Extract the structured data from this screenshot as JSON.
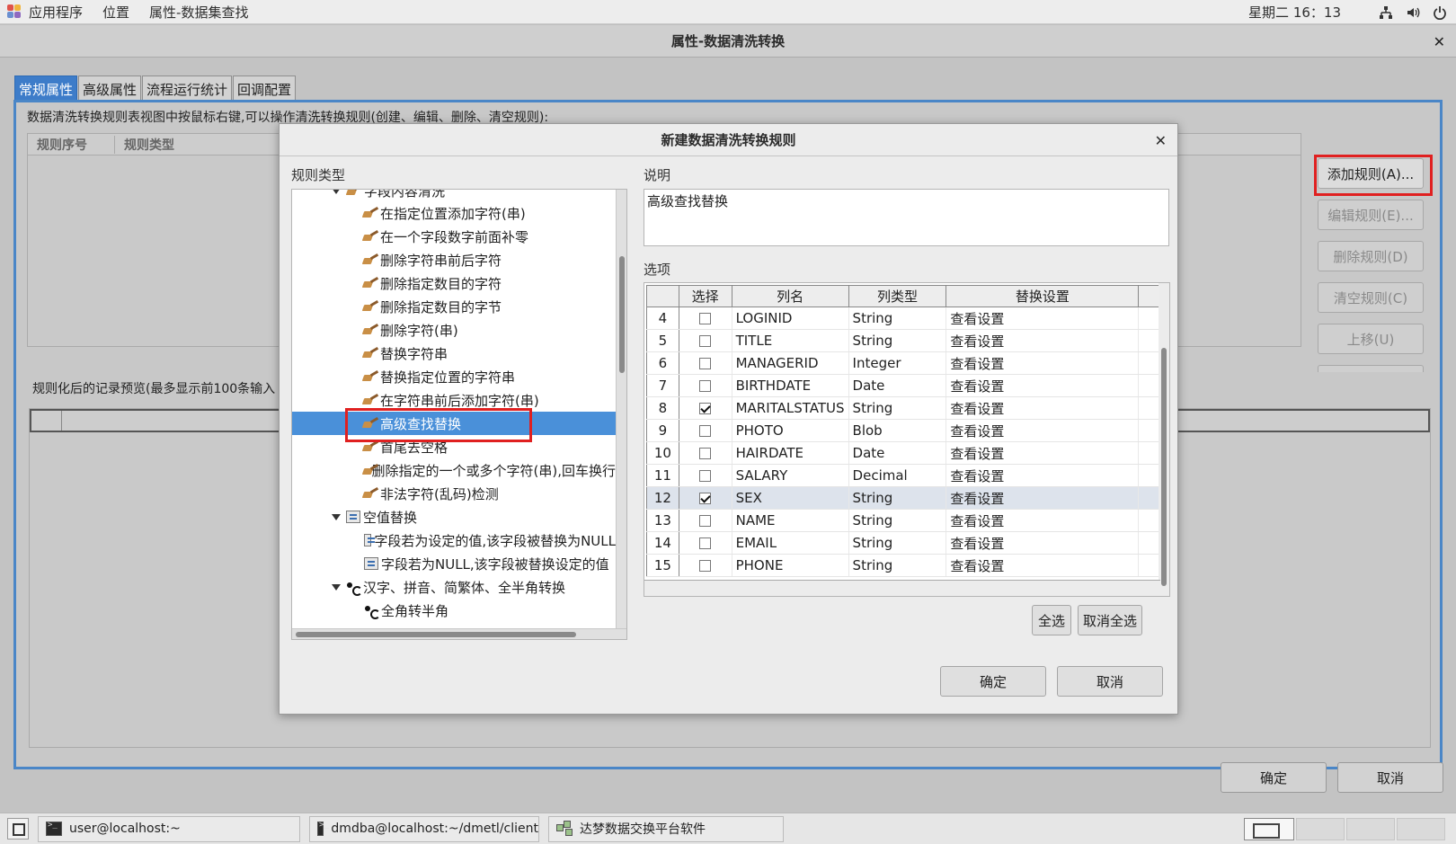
{
  "toppanel": {
    "apps_label": "应用程序",
    "places_label": "位置",
    "window_label": "属性-数据集查找",
    "clock": "星期二 16：13"
  },
  "mainwin": {
    "title": "属性-数据清洗转换",
    "tabs": [
      "常规属性",
      "高级属性",
      "流程运行统计",
      "回调配置"
    ],
    "description": "数据清洗转换规则表视图中按鼠标右键,可以操作清洗转换规则(创建、编辑、删除、清空规则):",
    "rule_columns": [
      "规则序号",
      "规则类型"
    ],
    "side_buttons": [
      "添加规则(A)...",
      "编辑规则(E)...",
      "删除规则(D)",
      "清空规则(C)",
      "上移(U)"
    ],
    "preview_label": "规则化后的记录预览(最多显示前100条输入",
    "ok_label": "确定",
    "cancel_label": "取消"
  },
  "dialog": {
    "title": "新建数据清洗转换规则",
    "rule_type_label": "规则类型",
    "desc_label": "说明",
    "desc_text": "高级查找替换",
    "options_label": "选项",
    "tree_partial_top": "字段内容清洗",
    "tree_items": [
      "在指定位置添加字符(串)",
      "在一个字段数字前面补零",
      "删除字符串前后字符",
      "删除指定数目的字符",
      "删除指定数目的字节",
      "删除字符(串)",
      "替换字符串",
      "替换指定位置的字符串",
      "在字符串前后添加字符(串)",
      "高级查找替换",
      "首尾去空格",
      "删除指定的一个或多个字符(串),回车换行",
      "非法字符(乱码)检测"
    ],
    "tree_group_null": "空值替换",
    "tree_null_items": [
      "字段若为设定的值,该字段被替换为NULL",
      "字段若为NULL,该字段被替换设定的值"
    ],
    "tree_group_chinese": "汉字、拼音、简繁体、全半角转换",
    "tree_chinese_items": [
      "全角转半角"
    ],
    "grid_columns": [
      "",
      "选择",
      "列名",
      "列类型",
      "替换设置"
    ],
    "grid_rows": [
      {
        "num": "4",
        "checked": false,
        "name": "LOGINID",
        "type": "String",
        "setting": "查看设置"
      },
      {
        "num": "5",
        "checked": false,
        "name": "TITLE",
        "type": "String",
        "setting": "查看设置"
      },
      {
        "num": "6",
        "checked": false,
        "name": "MANAGERID",
        "type": "Integer",
        "setting": "查看设置"
      },
      {
        "num": "7",
        "checked": false,
        "name": "BIRTHDATE",
        "type": "Date",
        "setting": "查看设置"
      },
      {
        "num": "8",
        "checked": true,
        "name": "MARITALSTATUS",
        "type": "String",
        "setting": "查看设置"
      },
      {
        "num": "9",
        "checked": false,
        "name": "PHOTO",
        "type": "Blob",
        "setting": "查看设置"
      },
      {
        "num": "10",
        "checked": false,
        "name": "HAIRDATE",
        "type": "Date",
        "setting": "查看设置"
      },
      {
        "num": "11",
        "checked": false,
        "name": "SALARY",
        "type": "Decimal",
        "setting": "查看设置"
      },
      {
        "num": "12",
        "checked": true,
        "name": "SEX",
        "type": "String",
        "setting": "查看设置"
      },
      {
        "num": "13",
        "checked": false,
        "name": "NAME",
        "type": "String",
        "setting": "查看设置"
      },
      {
        "num": "14",
        "checked": false,
        "name": "EMAIL",
        "type": "String",
        "setting": "查看设置"
      },
      {
        "num": "15",
        "checked": false,
        "name": "PHONE",
        "type": "String",
        "setting": "查看设置"
      }
    ],
    "select_all_label": "全选",
    "deselect_all_label": "取消全选",
    "ok_label": "确定",
    "cancel_label": "取消"
  },
  "taskbar": {
    "tasks": [
      "user@localhost:~",
      "dmdba@localhost:~/dmetl/client",
      "达梦数据交换平台软件"
    ]
  },
  "colors": {
    "selection": "#4a90d9",
    "tab_active": "#3d7cc9",
    "highlight_box": "#e02020"
  }
}
